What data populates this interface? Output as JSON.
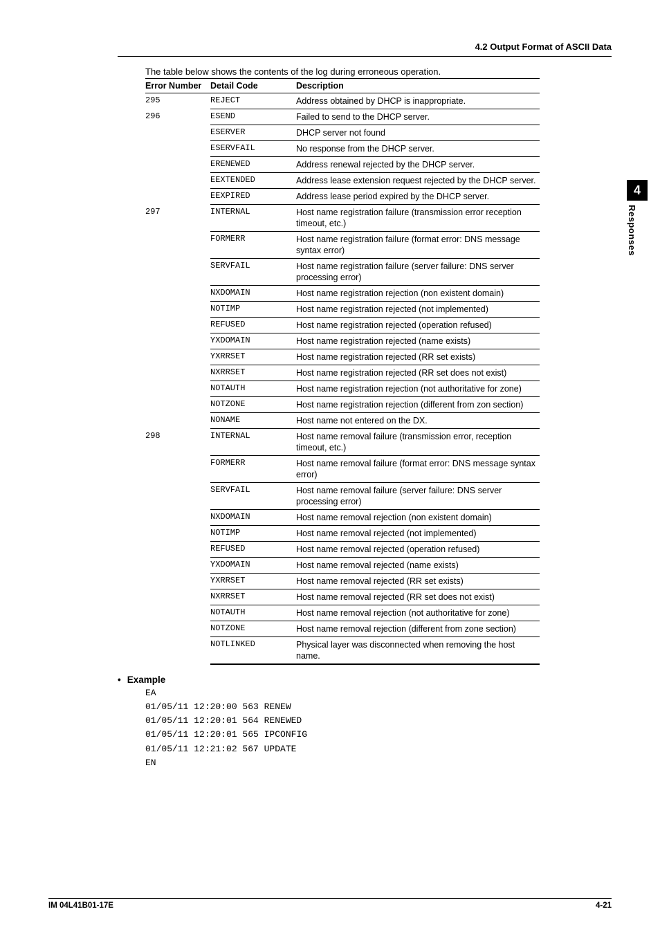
{
  "running_head": "4.2  Output Format of ASCII Data",
  "caption": "The table below shows the contents of the log during erroneous operation.",
  "columns": {
    "c1": "Error Number",
    "c2": "Detail Code",
    "c3": "Description"
  },
  "groups": [
    {
      "err": "295",
      "rows": [
        {
          "code": "REJECT",
          "desc": "Address obtained by DHCP is inappropriate."
        }
      ]
    },
    {
      "err": "296",
      "rows": [
        {
          "code": "ESEND",
          "desc": "Failed to send to the DHCP server."
        },
        {
          "code": "ESERVER",
          "desc": "DHCP server not found"
        },
        {
          "code": "ESERVFAIL",
          "desc": "No response from the DHCP server."
        },
        {
          "code": "ERENEWED",
          "desc": "Address renewal rejected by the DHCP server."
        },
        {
          "code": "EEXTENDED",
          "desc": "Address lease extension request rejected by the DHCP server."
        },
        {
          "code": "EEXPIRED",
          "desc": "Address lease period expired by the DHCP server."
        }
      ]
    },
    {
      "err": "297",
      "rows": [
        {
          "code": "INTERNAL",
          "desc": "Host name registration failure (transmission error reception timeout, etc.)"
        },
        {
          "code": "FORMERR",
          "desc": "Host name registration failure (format error: DNS message syntax error)"
        },
        {
          "code": "SERVFAIL",
          "desc": "Host name registration failure (server failure: DNS server processing error)"
        },
        {
          "code": "NXDOMAIN",
          "desc": "Host name registration rejection (non existent domain)"
        },
        {
          "code": "NOTIMP",
          "desc": "Host name registration rejected (not implemented)"
        },
        {
          "code": "REFUSED",
          "desc": "Host name registration rejected (operation refused)"
        },
        {
          "code": "YXDOMAIN",
          "desc": "Host name registration rejected (name exists)"
        },
        {
          "code": "YXRRSET",
          "desc": "Host name registration rejected (RR set exists)"
        },
        {
          "code": "NXRRSET",
          "desc": "Host name registration rejected (RR set does not exist)"
        },
        {
          "code": "NOTAUTH",
          "desc": "Host name registration rejection (not authoritative for zone)"
        },
        {
          "code": "NOTZONE",
          "desc": "Host name registration rejection (different from zon section)"
        },
        {
          "code": "NONAME",
          "desc": "Host name not entered on the DX."
        }
      ]
    },
    {
      "err": "298",
      "rows": [
        {
          "code": "INTERNAL",
          "desc": "Host name removal failure (transmission error, reception timeout, etc.)"
        },
        {
          "code": "FORMERR",
          "desc": "Host name removal failure (format error: DNS message syntax error)"
        },
        {
          "code": "SERVFAIL",
          "desc": "Host name removal failure (server failure: DNS server processing error)"
        },
        {
          "code": "NXDOMAIN",
          "desc": "Host name removal rejection (non existent domain)"
        },
        {
          "code": "NOTIMP",
          "desc": "Host name removal rejected (not implemented)"
        },
        {
          "code": "REFUSED",
          "desc": "Host name removal rejected (operation refused)"
        },
        {
          "code": "YXDOMAIN",
          "desc": "Host name removal rejected (name exists)"
        },
        {
          "code": "YXRRSET",
          "desc": "Host name removal rejected (RR set exists)"
        },
        {
          "code": "NXRRSET",
          "desc": "Host name removal rejected (RR set does not exist)"
        },
        {
          "code": "NOTAUTH",
          "desc": "Host name removal rejection (not authoritative for zone)"
        },
        {
          "code": "NOTZONE",
          "desc": "Host name removal rejection (different from zone section)"
        },
        {
          "code": "NOTLINKED",
          "desc": "Physical layer was disconnected when removing the host name."
        }
      ]
    }
  ],
  "example": {
    "heading": "Example",
    "lines": [
      "EA",
      "01/05/11 12:20:00 563 RENEW",
      "01/05/11 12:20:01 564 RENEWED",
      "01/05/11 12:20:01 565 IPCONFIG",
      "01/05/11 12:21:02 567 UPDATE",
      "EN"
    ]
  },
  "side": {
    "num": "4",
    "title": "Responses"
  },
  "footer": {
    "left": "IM 04L41B01-17E",
    "right": "4-21"
  }
}
